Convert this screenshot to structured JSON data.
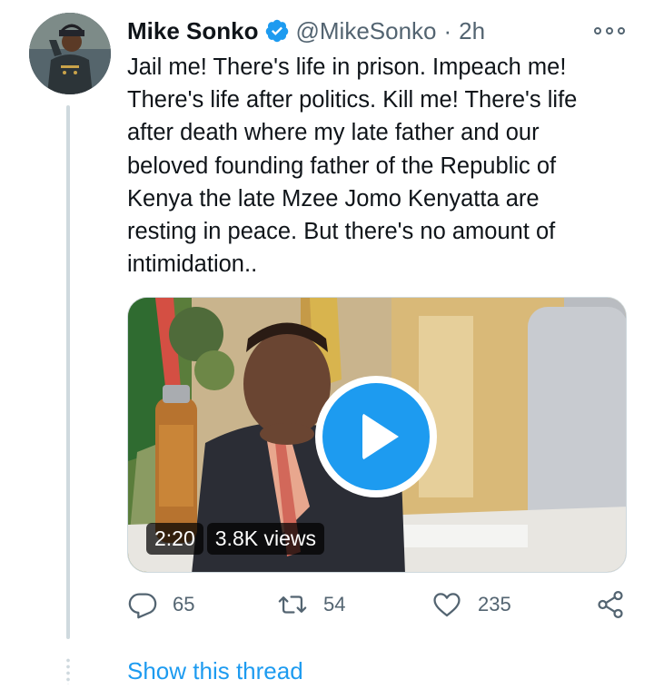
{
  "tweet": {
    "author_name": "Mike Sonko",
    "handle": "@MikeSonko",
    "separator": "·",
    "time": "2h",
    "text": "Jail me! There's life in prison. Impeach me!\nThere's life after politics. Kill me! There's life\nafter death where my late father and our\nbeloved founding father of the Republic of\nKenya the late Mzee Jomo Kenyatta are\nresting in peace. But there's no amount of\nintimidation..",
    "video": {
      "duration": "2:20",
      "views": "3.8K views"
    },
    "actions": {
      "replies": "65",
      "retweets": "54",
      "likes": "235"
    },
    "show_thread_label": "Show this thread"
  },
  "icons": {
    "verified": "verified-badge-icon",
    "more": "more-options-icon",
    "reply": "reply-icon",
    "retweet": "retweet-icon",
    "like": "heart-icon",
    "share": "share-icon",
    "play": "play-icon"
  },
  "colors": {
    "accent": "#1d9bf0",
    "text": "#0f1419",
    "secondary": "#536471",
    "line": "#cfd9de"
  }
}
